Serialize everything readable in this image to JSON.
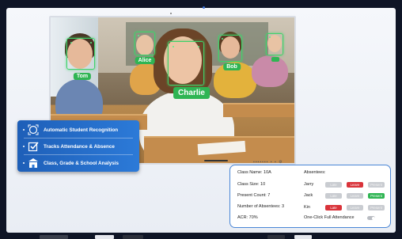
{
  "photo": {
    "students": [
      {
        "name": "Tom"
      },
      {
        "name": "Alice"
      },
      {
        "name": "Charlie"
      },
      {
        "name": "Bob"
      },
      {
        "name": ""
      }
    ]
  },
  "features": [
    {
      "label": "Automatic Student Recognition",
      "icon": "face-scan-icon"
    },
    {
      "label": "Tracks Attendance & Absence",
      "icon": "checkbox-icon"
    },
    {
      "label": "Class, Grade & School Analysis",
      "icon": "school-icon"
    }
  ],
  "info": {
    "class_name_label": "Class Name:",
    "class_name": "10A",
    "class_size_label": "Class Size:",
    "class_size": "10",
    "present_count_label": "Present Count:",
    "present_count": "7",
    "absentees_count_label": "Number of Absentees:",
    "absentees_count": "3",
    "acr_label": "ACR:",
    "acr": "70%",
    "absentees_title": "Absentees:",
    "absentees": [
      {
        "name": "Jarry",
        "late": "Late",
        "leave": "Leave",
        "present": "Present",
        "state": "leave"
      },
      {
        "name": "Jack",
        "late": "Late",
        "leave": "Leave",
        "present": "Present",
        "state": "present"
      },
      {
        "name": "Kin",
        "late": "Late",
        "leave": "Leave",
        "present": "Present",
        "state": "late"
      }
    ],
    "full_attendance_label": "One-Click Full Attendance",
    "full_attendance_on": false
  },
  "colors": {
    "accent_blue": "#2c7ad8",
    "recognition_green": "#2fb553",
    "alert_red": "#d9333a"
  }
}
